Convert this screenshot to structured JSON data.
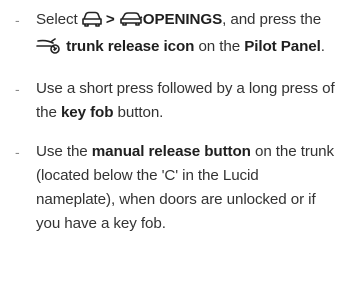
{
  "instructions": {
    "items": [
      {
        "bullet": "-",
        "t1": "Select ",
        "t2": " > ",
        "t3": "OPENINGS",
        "t4": ", and press the ",
        "t5": "trunk release icon",
        "t6": " on the ",
        "t7": "Pilot Panel",
        "t8": ".",
        "icons": [
          "car-front-icon",
          "car-openings-icon",
          "trunk-release-icon"
        ]
      },
      {
        "bullet": "-",
        "t1": "Use a short press followed by a long press of the ",
        "t2": "key fob",
        "t3": " button."
      },
      {
        "bullet": "-",
        "t1": "Use the ",
        "t2": "manual release button",
        "t3": " on the trunk (located below the 'C' in the Lucid nameplate), when doors are unlocked or if you have a key fob."
      }
    ]
  }
}
